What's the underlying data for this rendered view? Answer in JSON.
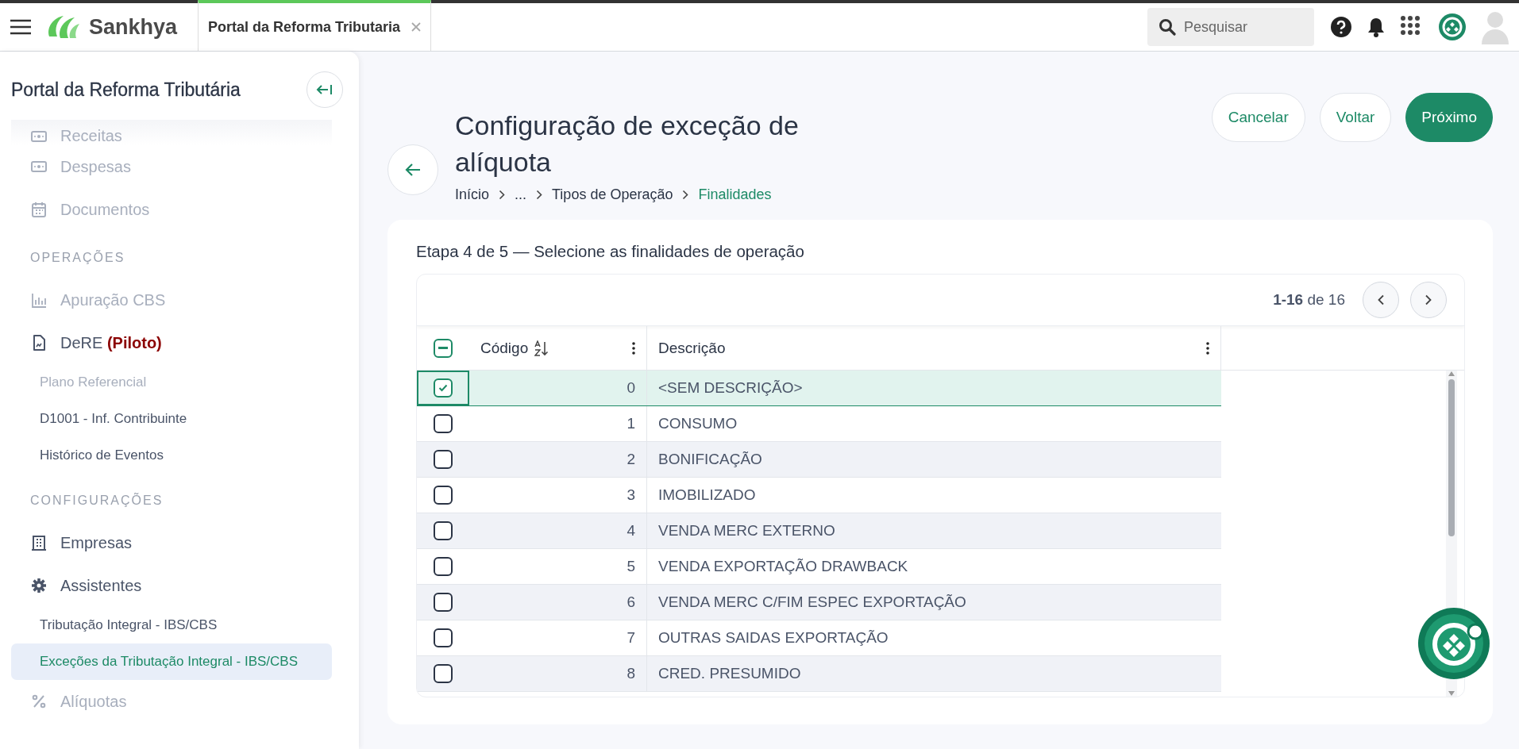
{
  "topbar": {
    "brand": "Sankhya",
    "tab": {
      "label": "Portal da Reforma Tributaria",
      "selected": true
    },
    "search": {
      "placeholder": "Pesquisar"
    }
  },
  "sidebar": {
    "title": "Portal da Reforma Tributária",
    "items": [
      {
        "kind": "item",
        "label": "Receitas",
        "disabled": true
      },
      {
        "kind": "item",
        "label": "Despesas",
        "disabled": true
      },
      {
        "kind": "item",
        "label": "Documentos",
        "disabled": true
      },
      {
        "kind": "section",
        "label": "OPERAÇÕES"
      },
      {
        "kind": "item",
        "label": "Apuração CBS",
        "disabled": true
      },
      {
        "kind": "item",
        "label": "DeRE **(Piloto)**",
        "disabled": false
      },
      {
        "kind": "sub",
        "label": "Plano Referencial",
        "disabled": true,
        "selected": false
      },
      {
        "kind": "sub",
        "label": "D1001 - Inf. Contribuinte",
        "disabled": false,
        "selected": false
      },
      {
        "kind": "sub",
        "label": "Histórico de Eventos",
        "disabled": false,
        "selected": false
      },
      {
        "kind": "section",
        "label": "CONFIGURAÇÕES"
      },
      {
        "kind": "item",
        "label": "Empresas",
        "disabled": false
      },
      {
        "kind": "item",
        "label": "Assistentes",
        "disabled": false
      },
      {
        "kind": "sub",
        "label": "Tributação Integral - IBS/CBS",
        "disabled": false,
        "selected": false
      },
      {
        "kind": "sub",
        "label": "Exceções da Tributação Integral - IBS/CBS",
        "disabled": false,
        "selected": true
      },
      {
        "kind": "item",
        "label": "Alíquotas",
        "disabled": true
      }
    ]
  },
  "header": {
    "title": "Configuração de exceção de alíquota",
    "breadcrumb": [
      {
        "label": "Início",
        "current": false
      },
      {
        "label": "...",
        "current": false
      },
      {
        "label": "Tipos de Operação",
        "current": false
      },
      {
        "label": "Finalidades",
        "current": true
      }
    ],
    "buttons": [
      {
        "label": "Cancelar",
        "primary": false
      },
      {
        "label": "Voltar",
        "primary": false
      },
      {
        "label": "Próximo",
        "primary": true
      }
    ]
  },
  "step": "Etapa 4 de 5 — Selecione as finalidades de operação",
  "pagination": "**1-16** de 16",
  "table": {
    "header_checkbox": {
      "indeterminate": true
    },
    "columns": [
      "Código",
      "Descrição"
    ],
    "rows": [
      {
        "code": "0",
        "description": "<SEM DESCRIÇÃO>",
        "checked": true,
        "selected": true
      },
      {
        "code": "1",
        "description": "CONSUMO",
        "checked": false,
        "selected": false
      },
      {
        "code": "2",
        "description": "BONIFICAÇÃO",
        "checked": false,
        "selected": false
      },
      {
        "code": "3",
        "description": "IMOBILIZADO",
        "checked": false,
        "selected": false
      },
      {
        "code": "4",
        "description": "VENDA MERC EXTERNO",
        "checked": false,
        "selected": false
      },
      {
        "code": "5",
        "description": "VENDA EXPORTAÇÃO DRAWBACK",
        "checked": false,
        "selected": false
      },
      {
        "code": "6",
        "description": "VENDA MERC C/FIM ESPEC EXPORTAÇÃO",
        "checked": false,
        "selected": false
      },
      {
        "code": "7",
        "description": "OUTRAS SAIDAS EXPORTAÇÃO",
        "checked": false,
        "selected": false
      },
      {
        "code": "8",
        "description": "CRED. PRESUMIDO",
        "checked": false,
        "selected": false
      }
    ]
  }
}
